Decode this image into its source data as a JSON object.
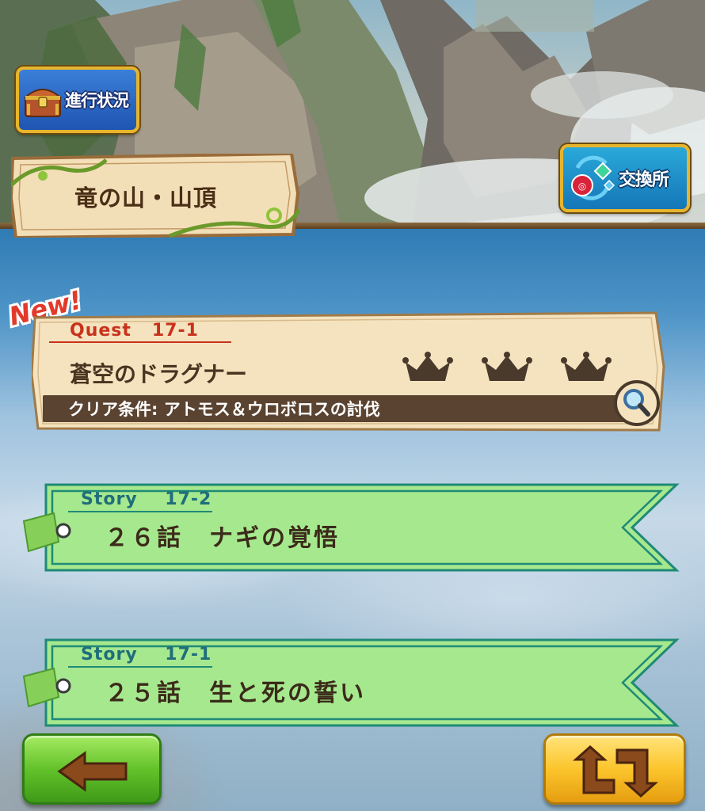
{
  "header": {
    "progress_button_label": "進行状況",
    "exchange_button_label": "交換所",
    "area_name": "竜の山・山頂"
  },
  "quest": {
    "badge": "New!",
    "code": "Quest   17-1",
    "title": "蒼空のドラグナー",
    "condition": "クリア条件: アトモス＆ウロボロスの討伐",
    "crowns_earned": 0,
    "crowns_total": 3
  },
  "stories": [
    {
      "code": "Story    17-2",
      "title": "２６話　ナギの覚悟"
    },
    {
      "code": "Story    17-1",
      "title": "２５話　生と死の誓い"
    }
  ],
  "colors": {
    "quest_code": "#c8321c",
    "story_ribbon": "#a6e88e",
    "story_border": "#1f8a76",
    "crown": "#4a3a2c"
  },
  "icons": {
    "progress": "treasure-chest-icon",
    "exchange": "exchange-orb-icon",
    "magnify": "magnifier-icon",
    "back": "left-arrow-icon",
    "swap": "swap-arrows-icon"
  }
}
